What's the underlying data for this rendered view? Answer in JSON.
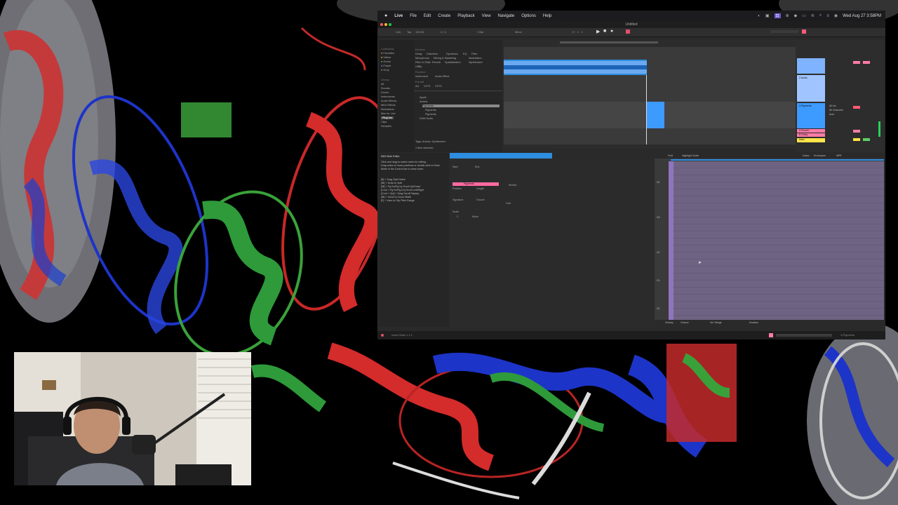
{
  "menubar": {
    "app_name": "Live",
    "items": [
      "File",
      "Edit",
      "Create",
      "Playback",
      "View",
      "Navigate",
      "Options",
      "Help"
    ],
    "clock": "Wed Aug 27 3:58PM"
  },
  "live": {
    "title": "Untitled",
    "controls": {
      "link": "Link",
      "tap": "Tap",
      "tempo": "126.00",
      "time_sig": "4 / 4",
      "bar": "1 Bar",
      "key": "Minor",
      "position": "17 . 1 . 1"
    },
    "browser": {
      "collections_header": "Collections",
      "collections": [
        "Favorites",
        "Yellow",
        "Green",
        "Purple",
        "Grey"
      ],
      "library_header": "Library",
      "library": [
        "All",
        "Sounds",
        "Drums",
        "Instruments",
        "Audio Effects",
        "MIDI Effects",
        "Modulators",
        "Max for Live",
        "Plug-ins",
        "Clips",
        "Samples"
      ],
      "devices_header": "Devices",
      "device_tags": [
        "Delay",
        "Distortion",
        "Dynamics",
        "EQ",
        "Filter",
        "Microphone",
        "Mixing & Mastering",
        "Modulation",
        "Pitch & Glide",
        "Reverb",
        "Spatialization",
        "Synthesizer",
        "Utility"
      ],
      "functions": [
        "Function",
        "Instrument",
        "Audio Effect"
      ],
      "formats": [
        "Format",
        "AU",
        "VST2",
        "VST3"
      ],
      "results": [
        "Apple",
        "Arturia",
        "Pigments",
        "Pigments",
        "Pigments",
        "DAW Audio"
      ],
      "footer": "1 item selected",
      "tags": "Tags: Arturia, Synthesizer"
    },
    "mixer": {
      "tracks": [
        "1 MIDI",
        "2 Audio",
        "3 Pigments",
        "A Reverb",
        "B Delay",
        "Main"
      ],
      "input_label": "All Ins",
      "channel_label": "All Channels",
      "monitor_label": "Auto"
    },
    "info": {
      "title": "MIDI Note Editor",
      "lines": [
        "Click and drag to select notes for editing.",
        "Drag notes to move positions or double-click in Draw",
        "Mode in the Control bar to draw notes.",
        "",
        "[B] + Drag Split Notes",
        "[⌘] + Draw to Split",
        "[⌘] + Pg Dn/Pg Up Scroll Up/Down",
        "[Cmd + Pg Dn/Pg Dn] Scroll Left/Right",
        "[Cmd + Opt] + Drag Scroll Display",
        "[⌘] + Scroll to Zoom Width",
        "[F] + View to Clip Pitch Range"
      ]
    },
    "clip": {
      "name": "Pigments",
      "start_label": "Start",
      "end_label": "End",
      "position_label": "Position",
      "length_label": "Length",
      "signature_label": "Signature",
      "groove_label": "Groove",
      "scale_label": "Scale",
      "scale_key": "C",
      "scale_name": "Minor",
      "loop_label": "Loop",
      "fold_label": "Fold",
      "stretch_label": "Stretch",
      "grid_label": "Grid"
    },
    "pianoroll": {
      "tabs": [
        "Fold",
        "Highlight Scale"
      ],
      "side_tabs": [
        "Notes",
        "Envelopes",
        "MPE"
      ],
      "note_labels": [
        "C4",
        "C3",
        "C2",
        "C1",
        "C0"
      ],
      "bottom": [
        "Velocity",
        "Chance",
        "Vel. Range",
        "Duration"
      ]
    },
    "status": {
      "left": "Insert Mark 1.1.1",
      "right": "3-Pigments"
    }
  },
  "colors": {
    "accent_orange": "#ff9b3c",
    "clip_blue": "#2d8ee0",
    "audio_clip_light": "#7fb3ff",
    "pigments_track": "#3d9aff",
    "reverb_pink": "#ff7ca8",
    "main_yellow": "#ffe44a",
    "pianoroll_bg": "#6f6383"
  }
}
